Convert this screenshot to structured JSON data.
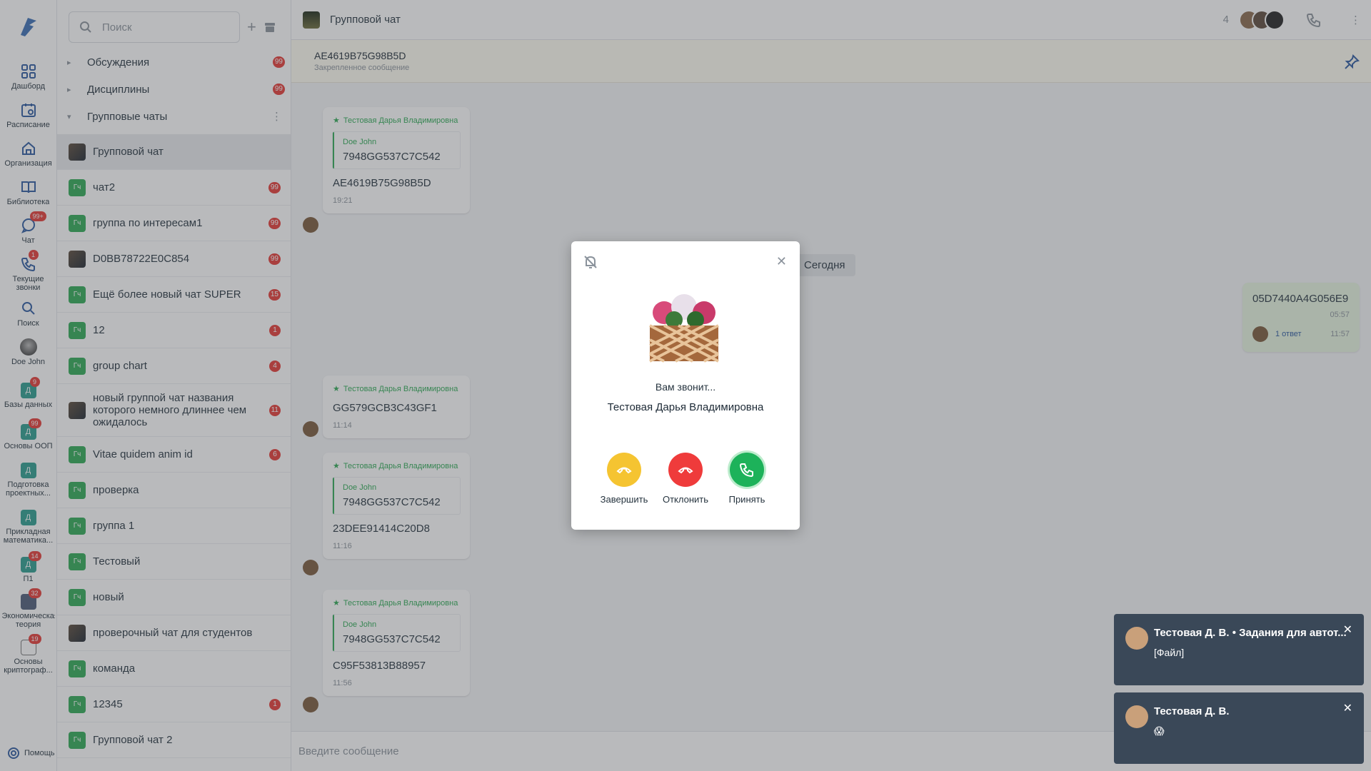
{
  "rail": {
    "items": [
      {
        "label": "Дашборд",
        "icon": "dashboard-icon"
      },
      {
        "label": "Расписание",
        "icon": "calendar-icon"
      },
      {
        "label": "Организация",
        "icon": "home-icon"
      },
      {
        "label": "Библиотека",
        "icon": "book-icon"
      },
      {
        "label": "Чат",
        "icon": "chat-icon",
        "badge": "99+"
      },
      {
        "label": "Текущие звонки",
        "icon": "phone-icon",
        "badge": "1"
      },
      {
        "label": "Поиск",
        "icon": "search-icon"
      },
      {
        "label": "Doe John",
        "icon": "avatar"
      }
    ],
    "courses": [
      {
        "label": "Базы данных",
        "letter": "Д",
        "badge": "9"
      },
      {
        "label": "Основы ООП",
        "letter": "Д",
        "badge": "99"
      },
      {
        "label": "Подготовка проектных...",
        "letter": "Д",
        "badge": ""
      },
      {
        "label": "Прикладная математика...",
        "letter": "Д",
        "badge": ""
      },
      {
        "label": "П1",
        "letter": "Д",
        "badge": "14"
      },
      {
        "label": "Экономическая теория",
        "letter": "",
        "badge": "32"
      },
      {
        "label": "Основы криптограф...",
        "letter": "",
        "badge": "19"
      }
    ],
    "help_label": "Помощь"
  },
  "list": {
    "search_placeholder": "Поиск",
    "sections": [
      {
        "label": "Обсуждения",
        "count": "99"
      },
      {
        "label": "Дисциплины",
        "count": "99"
      },
      {
        "label": "Групповые чаты",
        "count": ""
      }
    ],
    "chats": [
      {
        "name": "Групповой чат",
        "badge": "",
        "selected": true,
        "avatar": "image"
      },
      {
        "name": "чат2",
        "badge": "99",
        "avatar": "Гч"
      },
      {
        "name": "группа по интересам1",
        "badge": "99",
        "avatar": "Гч"
      },
      {
        "name": "D0BB78722E0C854",
        "badge": "99",
        "avatar": "image"
      },
      {
        "name": "Ещё более новый чат SUPER",
        "badge": "15",
        "avatar": "Гч"
      },
      {
        "name": "12",
        "badge": "1",
        "avatar": "Гч"
      },
      {
        "name": "group chart",
        "badge": "4",
        "avatar": "Гч"
      },
      {
        "name": "новый группой чат названия которого немного длиннее чем ожидалось",
        "badge": "11",
        "avatar": "image"
      },
      {
        "name": "Vitae quidem anim id",
        "badge": "6",
        "avatar": "Гч"
      },
      {
        "name": "проверка",
        "badge": "",
        "avatar": "Гч"
      },
      {
        "name": "группа 1",
        "badge": "",
        "avatar": "Гч"
      },
      {
        "name": "Тестовый",
        "badge": "",
        "avatar": "Гч"
      },
      {
        "name": "новый",
        "badge": "",
        "avatar": "Гч"
      },
      {
        "name": "проверочный чат для студентов",
        "badge": "",
        "avatar": "image"
      },
      {
        "name": "команда",
        "badge": "",
        "avatar": "Гч"
      },
      {
        "name": "12345",
        "badge": "1",
        "avatar": "Гч"
      },
      {
        "name": "Групповой чат 2",
        "badge": "",
        "avatar": "Гч"
      }
    ]
  },
  "header": {
    "title": "Групповой чат",
    "members": "4"
  },
  "pinned": {
    "text": "AE4619B75G98B5D",
    "sub": "Закрепленное сообщение"
  },
  "messages": [
    {
      "author": "Тестовая Дарья Владимировна",
      "quote_author": "Doe John",
      "quote": "7948GG537C7C542",
      "text": "AE4619B75G98B5D",
      "time": "19:21"
    },
    {
      "author": "Тестовая Дарья Владимировна",
      "quote_author": "",
      "quote": "",
      "text": "GG579GCB3C43GF1",
      "time": "11:14"
    },
    {
      "author": "Тестовая Дарья Владимировна",
      "quote_author": "Doe John",
      "quote": "7948GG537C7C542",
      "text": "23DEE91414C20D8",
      "time": "11:16"
    },
    {
      "author": "Тестовая Дарья Владимировна",
      "quote_author": "Doe John",
      "quote": "7948GG537C7C542",
      "text": "C95F53813B88957",
      "time": "11:56"
    }
  ],
  "today_label": "Сегодня",
  "my_message": {
    "text": "05D7440A4G056E9",
    "time": "05:57",
    "replies": "1 ответ",
    "reply_time": "11:57"
  },
  "composer_placeholder": "Введите сообщение",
  "call": {
    "calling": "Вам звонит...",
    "caller": "Тестовая Дарья Владимировна",
    "end_label": "Завершить",
    "decline_label": "Отклонить",
    "accept_label": "Принять",
    "colors": {
      "end": "#f5c431",
      "decline": "#ef3b3b",
      "accept": "#1db25a"
    }
  },
  "toasts": [
    {
      "title": "Тестовая Д. В. • Задания для автот...",
      "body": "[Файл]"
    },
    {
      "title": "Тестовая Д. В.",
      "body": "😱"
    }
  ]
}
